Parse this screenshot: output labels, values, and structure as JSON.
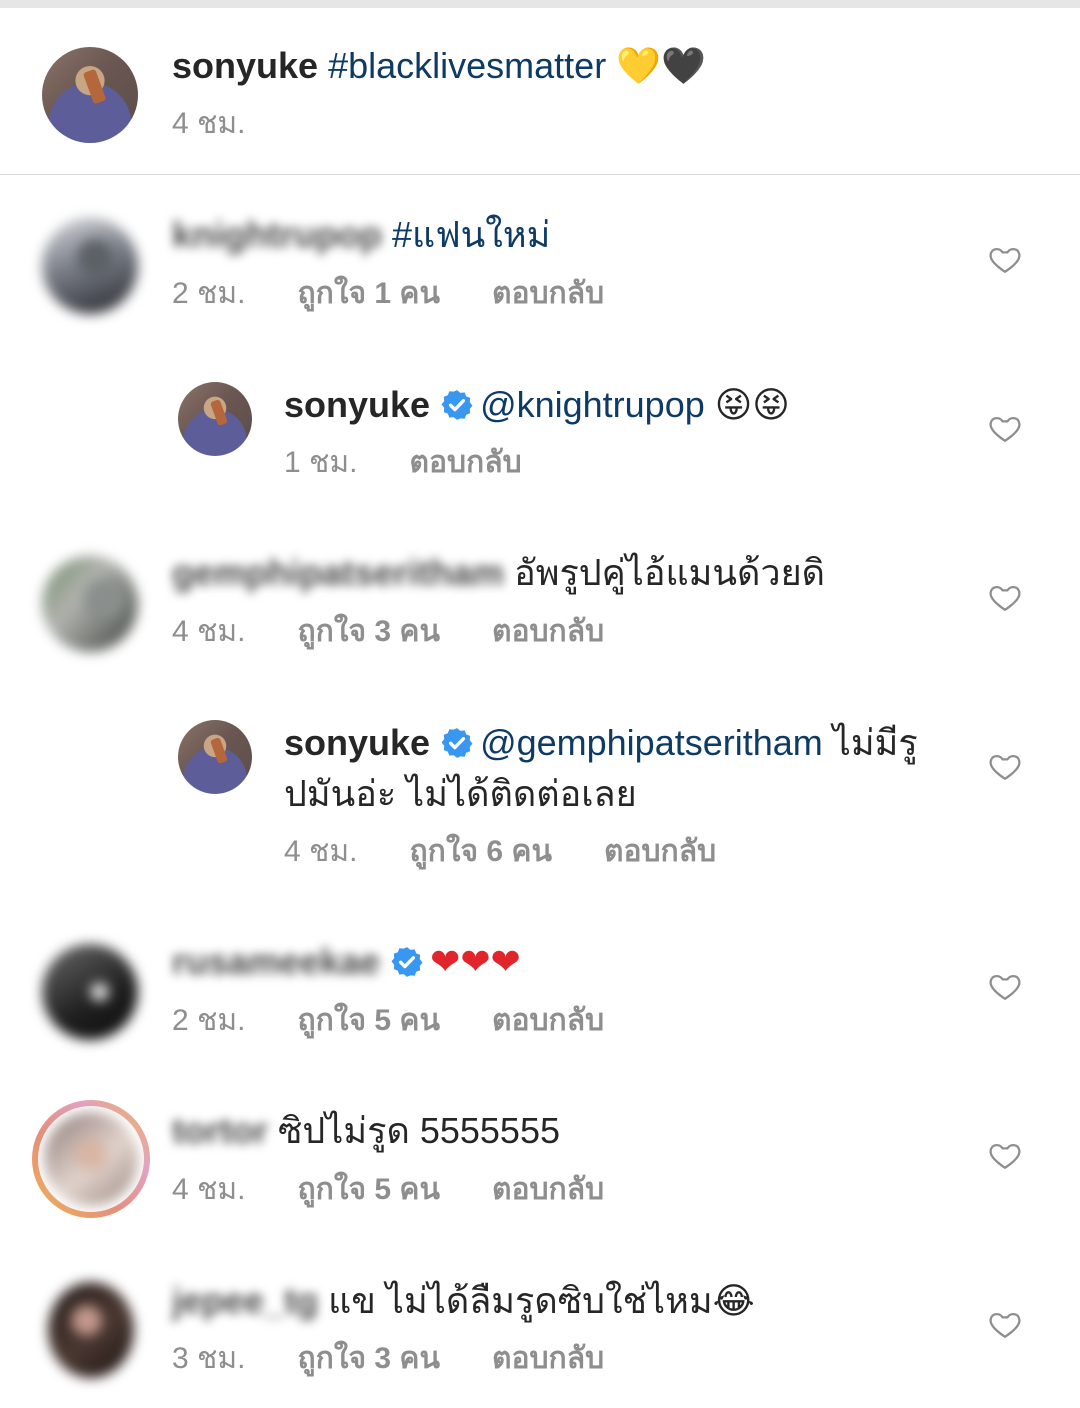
{
  "caption": {
    "username": "sonyuke",
    "hashtag": "#blacklivesmatter",
    "emoji": "💛🖤",
    "time": "4 ชม."
  },
  "comments": [
    {
      "username": "knightrupop",
      "text": "#แฟนใหม่",
      "time": "2 ชม.",
      "likes": "ถูกใจ 1 คน",
      "reply": "ตอบกลับ"
    },
    {
      "username": "sonyuke",
      "mention": "@knightrupop",
      "emoji": "😝😝",
      "time": "1 ชม.",
      "reply": "ตอบกลับ"
    },
    {
      "username": "gemphipatseritham",
      "text": "อัพรูปคู่ไอ้แมนด้วยดิ",
      "time": "4 ชม.",
      "likes": "ถูกใจ 3 คน",
      "reply": "ตอบกลับ"
    },
    {
      "username": "sonyuke",
      "mention": "@gemphipatseritham",
      "text_a": "ไม่มีรู",
      "text_b": "ปมันอ่ะ ไม่ได้ติดต่อเลย",
      "time": "4 ชม.",
      "likes": "ถูกใจ 6 คน",
      "reply": "ตอบกลับ"
    },
    {
      "username": "rusameekae",
      "emoji": "❤❤❤",
      "time": "2 ชม.",
      "likes": "ถูกใจ 5 คน",
      "reply": "ตอบกลับ"
    },
    {
      "username": "tortor",
      "text": "ซิปไม่รูด 5555555",
      "time": "4 ชม.",
      "likes": "ถูกใจ 5 คน",
      "reply": "ตอบกลับ"
    },
    {
      "username": "jepee_tg",
      "text": "แข ไม่ได้ลืมรูดซิบใช่ไหม",
      "emoji": "😂",
      "time": "3 ชม.",
      "likes": "ถูกใจ 3 คน",
      "reply": "ตอบกลับ"
    }
  ],
  "colors": {
    "link": "#0d3b66",
    "meta": "#8e8e8e",
    "verified": "#3897f0",
    "heart_emoji": "#e0262b"
  },
  "icons": {
    "like": "heart-outline-icon",
    "verified": "verified-badge-icon"
  }
}
